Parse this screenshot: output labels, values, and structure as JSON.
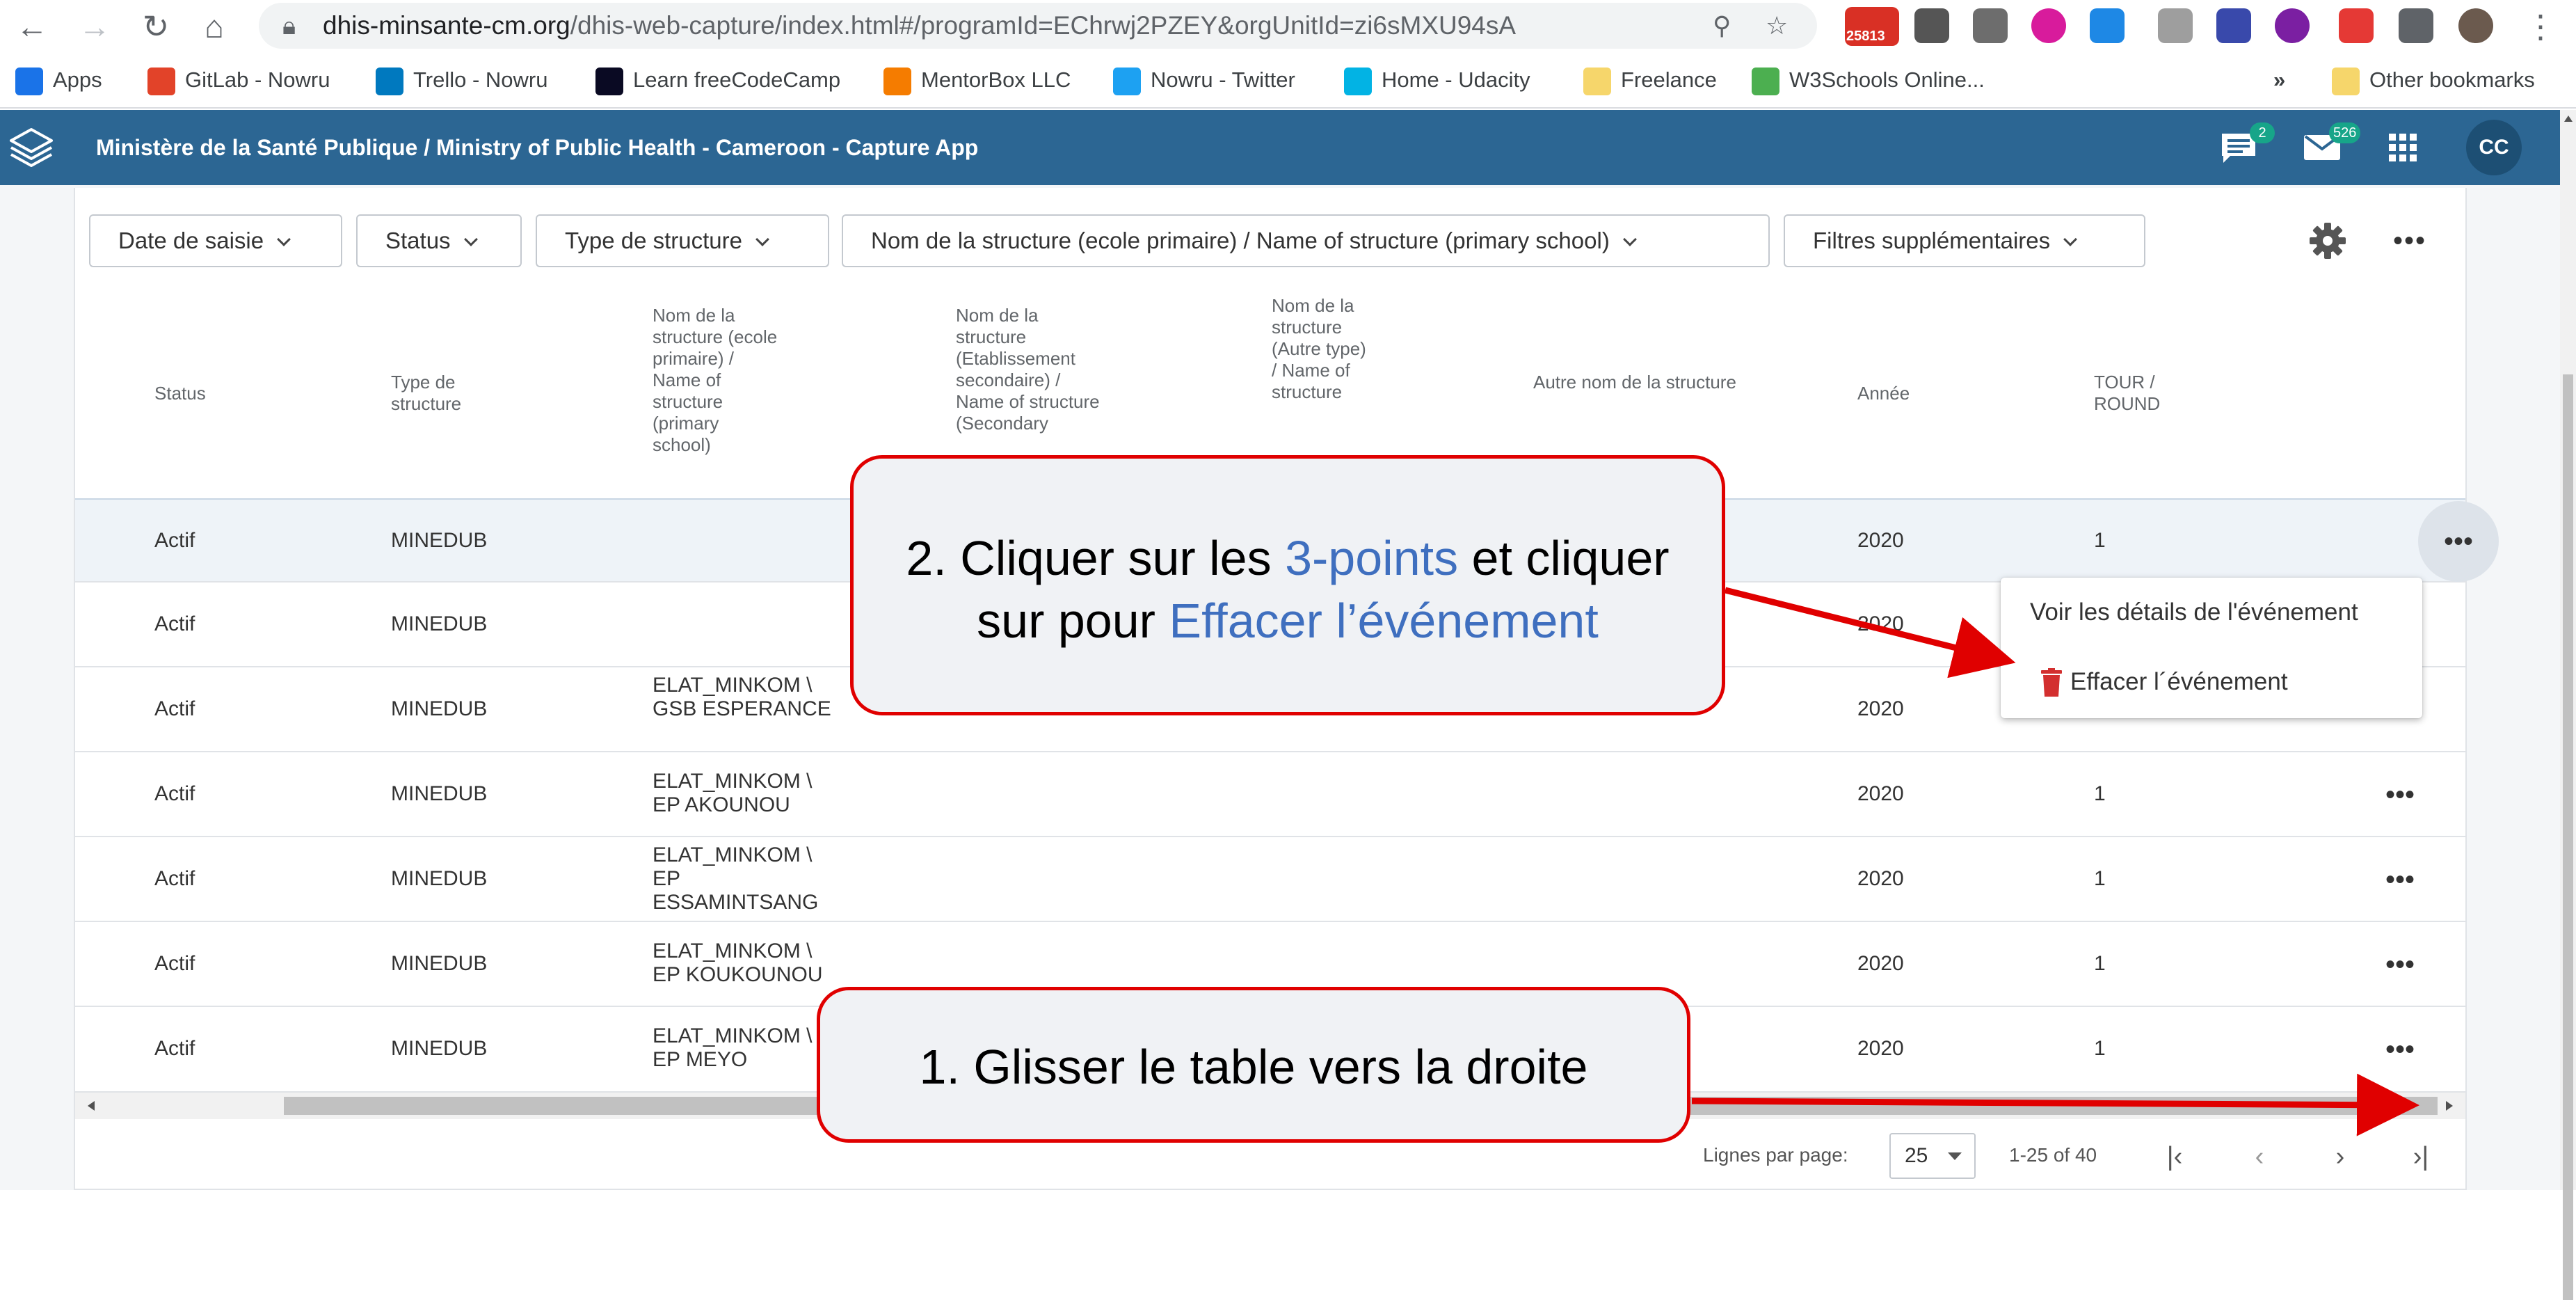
{
  "browser": {
    "url_host": "dhis-minsante-cm.org",
    "url_path": "/dhis-web-capture/index.html#/programId=EChrwj2PZEY&orgUnitId=zi6sMXU94sA",
    "mail_badge": "25813",
    "bookmarks": [
      {
        "label": "Apps",
        "color": "#1a73e8"
      },
      {
        "label": "GitLab - Nowru",
        "color": "#e24329"
      },
      {
        "label": "Trello - Nowru",
        "color": "#0079bf"
      },
      {
        "label": "Learn freeCodeCamp",
        "color": "#0a0a23"
      },
      {
        "label": "MentorBox LLC",
        "color": "#f57c00"
      },
      {
        "label": "Nowru - Twitter",
        "color": "#1da1f2"
      },
      {
        "label": "Home - Udacity",
        "color": "#02b3e4"
      },
      {
        "label": "Freelance",
        "color": "#f6d66b"
      },
      {
        "label": "W3Schools Online...",
        "color": "#4caf50"
      }
    ],
    "bookmarks_more": "»",
    "other_bookmarks": "Other bookmarks"
  },
  "header": {
    "title": "Ministère de la Santé Publique / Ministry of Public Health - Cameroon - Capture App",
    "messages_badge": "2",
    "mail_badge": "526",
    "profile_initials": "CC",
    "header_color": "#2c6693"
  },
  "filters": [
    "Date de saisie",
    "Status",
    "Type de structure",
    "Nom de la structure (ecole primaire) / Name of structure (primary school)",
    "Filtres supplémentaires"
  ],
  "table": {
    "columns": [
      "Status",
      "Type de structure",
      "Nom de la structure (ecole primaire) / Name of structure (primary school)",
      "Nom de la structure (Etablissement secondaire) / Name of structure (Secondary",
      "Nom de la structure (Autre type) / Name of structure",
      "Autre nom de la structure",
      "Année",
      "TOUR / ROUND"
    ],
    "rows": [
      {
        "status": "Actif",
        "type": "MINEDUB",
        "primary": "",
        "year": "2020",
        "round": "1"
      },
      {
        "status": "Actif",
        "type": "MINEDUB",
        "primary": "",
        "year": "2020",
        "round": ""
      },
      {
        "status": "Actif",
        "type": "MINEDUB",
        "primary": "ELAT_MINKOM \\ GSB ESPERANCE",
        "year": "2020",
        "round": ""
      },
      {
        "status": "Actif",
        "type": "MINEDUB",
        "primary": "ELAT_MINKOM \\ EP AKOUNOU",
        "year": "2020",
        "round": "1"
      },
      {
        "status": "Actif",
        "type": "MINEDUB",
        "primary": "ELAT_MINKOM \\ EP ESSAMINTSANG",
        "year": "2020",
        "round": "1"
      },
      {
        "status": "Actif",
        "type": "MINEDUB",
        "primary": "ELAT_MINKOM \\ EP KOUKOUNOU",
        "year": "2020",
        "round": "1"
      },
      {
        "status": "Actif",
        "type": "MINEDUB",
        "primary": "ELAT_MINKOM \\ EP MEYO",
        "year": "2020",
        "round": "1"
      }
    ],
    "row_menu_icon": "•••"
  },
  "pagination": {
    "rows_per_page_label": "Lignes par page:",
    "rows_per_page": "25",
    "range": "1-25 of 40"
  },
  "context_menu": {
    "view": "Voir les détails de l'événement",
    "delete": "Effacer l´événement",
    "delete_icon_color": "#d32f2f"
  },
  "annotations": {
    "step2_a": "2. Cliquer sur les ",
    "step2_b": "3-points",
    "step2_c": " et cliquer",
    "step2_d": "sur pour ",
    "step2_e": "Effacer l’événement",
    "step1": "1. Glisser le table vers la droite",
    "highlight_color": "#3f6fbf",
    "arrow_color": "#e00000"
  }
}
